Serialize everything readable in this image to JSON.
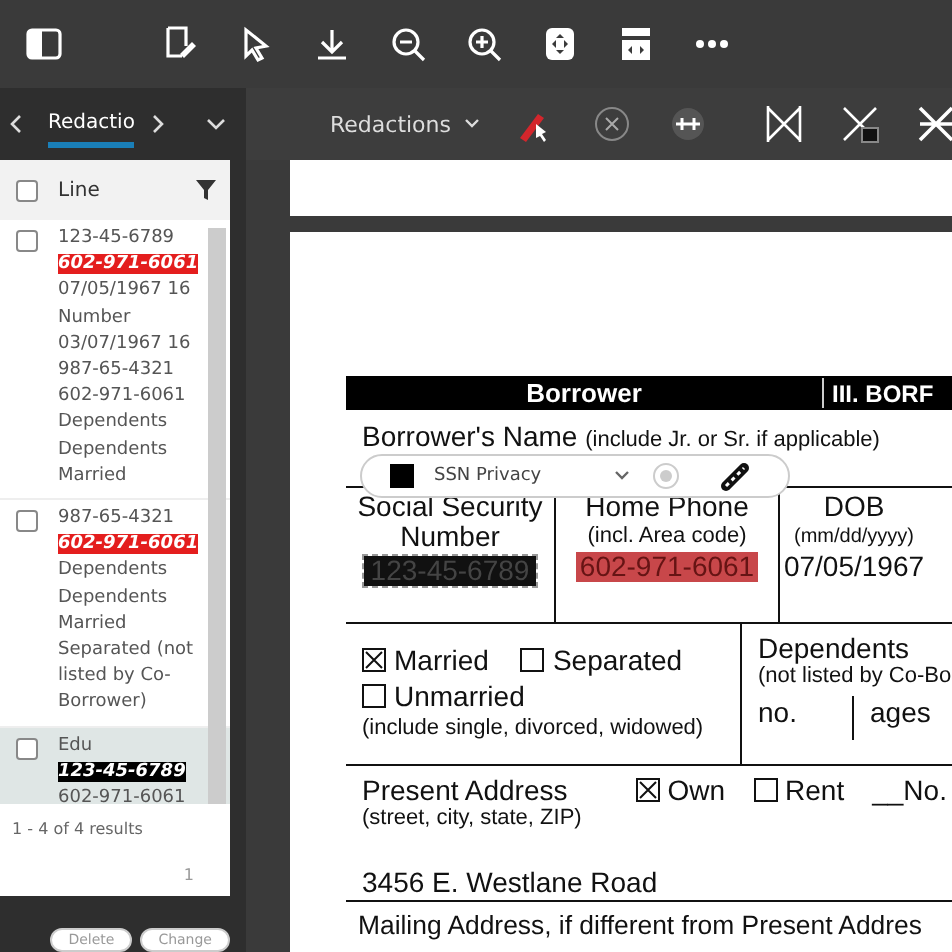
{
  "sidebar": {
    "tab": "Redactio",
    "header": {
      "label": "Line",
      "checked": false
    },
    "items": [
      {
        "checked": false,
        "selected": false,
        "lines": [
          [
            {
              "text": "123-45-6789"
            }
          ],
          [
            {
              "text": "602-971-6061",
              "color": "#e41e1e"
            }
          ],
          [
            {
              "text": "07/05/1967 16"
            }
          ],
          [
            {
              "text": "Number"
            }
          ],
          [
            {
              "text": "03/07/1967 16"
            }
          ],
          [
            {
              "text": "987-65-4321"
            }
          ],
          [
            {
              "text": "602-971-6061"
            }
          ],
          [
            {
              "text": "Dependents"
            }
          ],
          [
            {
              "text": "Dependents"
            }
          ],
          [
            {
              "text": "Married"
            }
          ]
        ]
      },
      {
        "checked": false,
        "selected": false,
        "lines": [
          [
            {
              "text": "987-65-4321"
            }
          ],
          [
            {
              "text": "602-971-6061",
              "color": "#e41e1e"
            }
          ],
          [
            {
              "text": "Dependents"
            }
          ],
          [
            {
              "text": "Dependents"
            }
          ],
          [
            {
              "text": "Married"
            }
          ],
          [
            {
              "text": "Separated (not listed by Co-Borrower)"
            }
          ]
        ]
      },
      {
        "checked": false,
        "selected": true,
        "lines": [
          [
            {
              "text": "Edu"
            },
            {
              "text": "123-45-6789",
              "color": "#000000"
            },
            {
              "text": "602-971-6061"
            }
          ]
        ]
      }
    ],
    "results": "1 - 4 of 4 results",
    "page": "1",
    "buttons": [
      "Delete",
      "Change"
    ]
  },
  "doc_toolbar": {
    "dropdown": "Redactions"
  },
  "popup": {
    "label": "SSN Privacy",
    "color": "#000000"
  },
  "document": {
    "header": [
      "Borrower",
      "III. BORF"
    ],
    "name_label": "Borrower's Name",
    "name_hint": "(include Jr. or Sr. if applicable)",
    "ssn": {
      "label": "Social Security Number",
      "value": "123-45-6789"
    },
    "phone": {
      "label": "Home Phone",
      "hint": "(incl. Area code)",
      "value": "602-971-6061",
      "color": "#c8474a"
    },
    "dob": {
      "label": "DOB",
      "hint": "(mm/dd/yyyy)",
      "value": "07/05/1967"
    },
    "marital": [
      {
        "label": "Married",
        "checked": true
      },
      {
        "label": "Separated",
        "checked": false
      },
      {
        "label": "Unmarried",
        "checked": false
      }
    ],
    "marital_hint": "(include single, divorced, widowed)",
    "dependents": {
      "label": "Dependents",
      "hint": "(not listed by Co-Bo",
      "no": "no.",
      "ages": "ages"
    },
    "address": {
      "label": "Present Address",
      "hint": "(street, city, state, ZIP)",
      "options": [
        {
          "label": "Own",
          "checked": true
        },
        {
          "label": "Rent",
          "checked": false
        }
      ],
      "years": "__No.",
      "value": "3456 E. Westlane Road"
    },
    "mailing": "Mailing Address, if different from Present Addres"
  }
}
